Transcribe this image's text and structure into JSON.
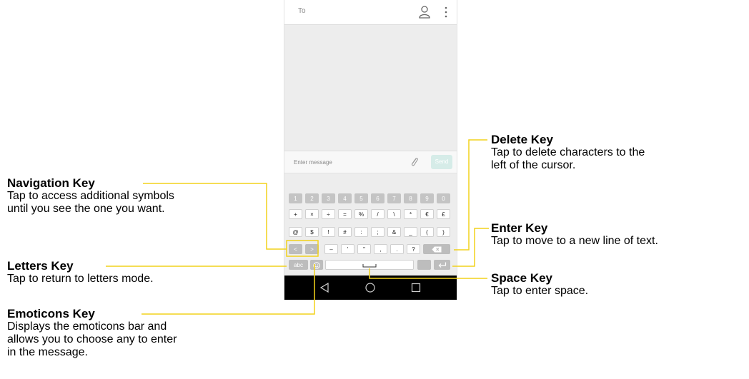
{
  "phone": {
    "to_label": "To",
    "message_placeholder": "Enter message",
    "send_label": "Send",
    "keyboard": {
      "row1": [
        "1",
        "2",
        "3",
        "4",
        "5",
        "6",
        "7",
        "8",
        "9",
        "0"
      ],
      "row2": [
        "+",
        "×",
        "÷",
        "=",
        "%",
        "/",
        "\\",
        "*",
        "€",
        "£"
      ],
      "row3": [
        "@",
        "$",
        "!",
        "#",
        ":",
        ";",
        "&",
        "_",
        "(",
        ")"
      ],
      "row4_nav": [
        "<",
        ">"
      ],
      "row4": [
        "–",
        "'",
        "\"",
        ",",
        ".",
        "?"
      ],
      "abc_label": "abc"
    }
  },
  "annotations": {
    "navigation": {
      "title": "Navigation Key",
      "desc": [
        "Tap to access additional symbols",
        "until you see the one you want."
      ]
    },
    "letters": {
      "title": "Letters Key",
      "desc": [
        "Tap to return to letters mode."
      ]
    },
    "emoticons": {
      "title": "Emoticons Key",
      "desc": [
        "Displays the emoticons bar and",
        "allows you to choose any to enter",
        "in the message."
      ]
    },
    "delete": {
      "title": "Delete Key",
      "desc": [
        "Tap to delete characters to the",
        "left of the cursor."
      ]
    },
    "enter": {
      "title": "Enter Key",
      "desc": [
        "Tap to move to a new line of text."
      ]
    },
    "space": {
      "title": "Space Key",
      "desc": [
        "Tap to enter space."
      ]
    }
  },
  "colors": {
    "callout_line": "#f2d21b",
    "send_button": "#d6ece8"
  }
}
